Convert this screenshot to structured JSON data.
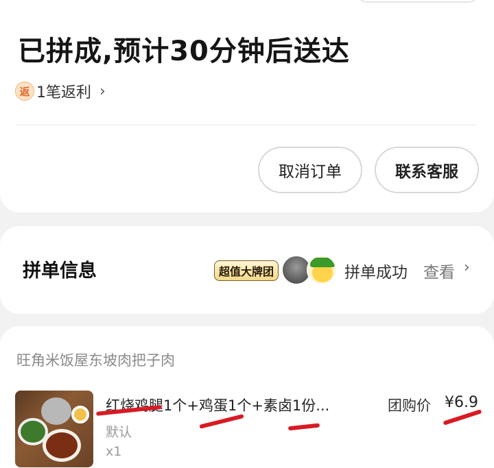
{
  "status": {
    "title": "已拼成,预计30分钟后送达",
    "rebate_badge": "返",
    "rebate_text": "1笔返利",
    "rebate_chevron": "›"
  },
  "actions": {
    "cancel_label": "取消订单",
    "service_label": "联系客服"
  },
  "group": {
    "label": "拼单信息",
    "badge": "超值大牌团",
    "status": "拼单成功",
    "view": "查看",
    "chevron": "›"
  },
  "order": {
    "shop_name": "旺角米饭屋东坡肉把子肉",
    "item": {
      "name": "红烧鸡腿1个+鸡蛋1个+素卤1份...",
      "spec": "默认",
      "qty": "x1",
      "price_label": "团购价",
      "price": "¥6.9"
    }
  },
  "colors": {
    "background": "#f2f2f2",
    "card": "#ffffff",
    "annotation_red": "#d81b24",
    "rebate_orange": "#e2672b"
  }
}
